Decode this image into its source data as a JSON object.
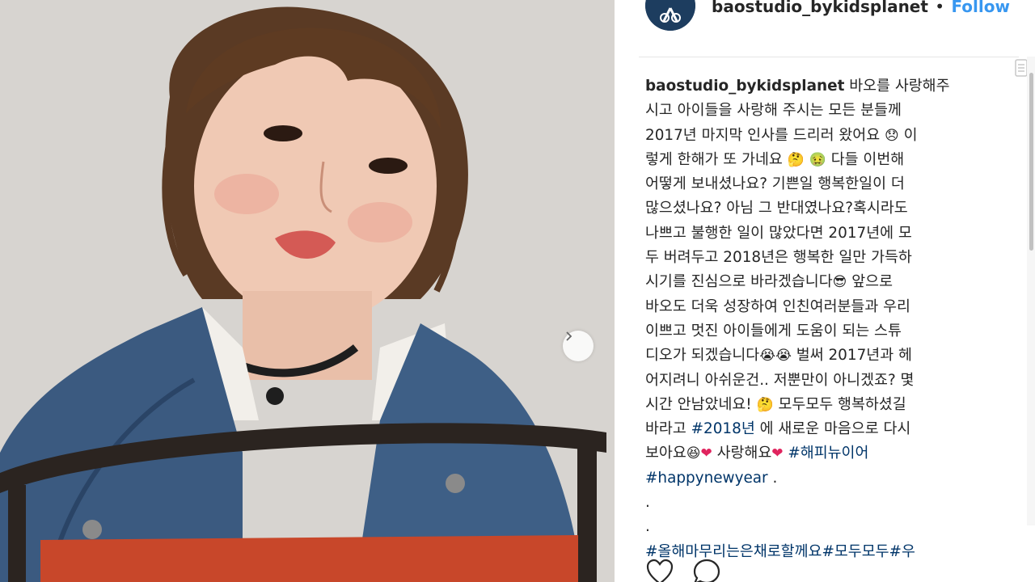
{
  "post": {
    "username": "baostudio_bykidsplanet",
    "separator": "•",
    "follow_label": "Follow"
  },
  "icons": {
    "avatar": "studio-logo",
    "next": "chevron-right-icon",
    "more": "more-options-icon",
    "like": "heart-icon",
    "comment": "comment-icon"
  },
  "colors": {
    "link": "#3897f0",
    "hashtag": "#003569",
    "text": "#262626",
    "avatar_bg": "#1d3d5f"
  },
  "caption": {
    "user": "baostudio_bykidsplanet",
    "lines": [
      " 바오를 사랑해주",
      "시고 아이들을 사랑해 주시는 모든 분들께",
      "2017년 마지막 인사를 드리러 왔어요 ",
      "렇게 한해가 또 가네요 ",
      "어떻게 보내셨나요? 기쁜일 행복한일이 더",
      "많으셨나요? 아님 그 반대였나요?혹시라도",
      "나쁘고 불행한 일이 많았다면 2017년에 모",
      "두 버려두고 2018년은 행복한 일만 가득하",
      "시기를 진심으로 바라겠습니다",
      "바오도 더욱 성장하여 인친여러분들과 우리",
      "이쁘고 멋진 아이들에게 도움이 되는 스튜",
      "디오가 되겠습니다",
      "어지려니 아쉬운건.. 저뿐만이 아니겠죠? 몇",
      "시간 안남았네요! ",
      "바라고 ",
      "보아요",
      ".",
      ".",
      "#올해마무리는은채로할께요#모두모두#우"
    ],
    "seg": {
      "l3_end": " 이",
      "l4_end": " 다들 이번해",
      "l9_end": " 앞으로",
      "l12_end": "  벌써 2017년과 헤",
      "l14_end": " 모두모두 행복하셨길",
      "l15_tag": "#2018년",
      "l15_end": " 에 새로운 마음으로 다시",
      "l16_mid": " 사랑해요",
      "l16_tag": "#해피뉴이어",
      "l17_tag": "#happynewyear",
      "l17_end": " ."
    },
    "emoji": {
      "sad": "😞",
      "thinking": "🤔",
      "sick": "🤢",
      "cool": "😎",
      "cry": "😭",
      "squint": "😆",
      "heart": "❤"
    }
  },
  "photo": {
    "description_icon": "photo-of-child"
  }
}
